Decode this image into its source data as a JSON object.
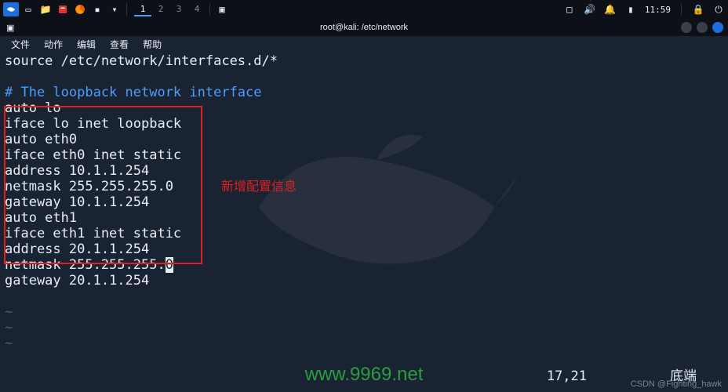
{
  "topbar": {
    "workspaces": [
      "1",
      "2",
      "3",
      "4"
    ],
    "active_workspace": 0,
    "clock": "11:59"
  },
  "window": {
    "title": "root@kali: /etc/network"
  },
  "menubar": {
    "items": [
      "文件",
      "动作",
      "编辑",
      "查看",
      "帮助"
    ]
  },
  "editor": {
    "lines": [
      {
        "text": "source /etc/network/interfaces.d/*",
        "cls": ""
      },
      {
        "text": "",
        "cls": ""
      },
      {
        "text": "# The loopback network interface",
        "cls": "comment"
      },
      {
        "text": "auto lo",
        "cls": ""
      },
      {
        "text": "iface lo inet loopback",
        "cls": ""
      },
      {
        "text": "auto eth0",
        "cls": ""
      },
      {
        "text": "iface eth0 inet static",
        "cls": ""
      },
      {
        "text": "address 10.1.1.254",
        "cls": ""
      },
      {
        "text": "netmask 255.255.255.0",
        "cls": ""
      },
      {
        "text": "gateway 10.1.1.254",
        "cls": ""
      },
      {
        "text": "auto eth1",
        "cls": ""
      },
      {
        "text": "iface eth1 inet static",
        "cls": ""
      },
      {
        "text": "address 20.1.1.254",
        "cls": ""
      }
    ],
    "cursor_line_pre": "netmask 255.255.255.",
    "cursor_char": "0",
    "after_lines": [
      {
        "text": "gateway 20.1.1.254",
        "cls": ""
      },
      {
        "text": "",
        "cls": ""
      },
      {
        "text": "~",
        "cls": "tilde"
      },
      {
        "text": "~",
        "cls": "tilde"
      },
      {
        "text": "~",
        "cls": "tilde"
      }
    ]
  },
  "annotation": "新增配置信息",
  "status": {
    "position": "17,21",
    "mode": "底端"
  },
  "watermark": {
    "url": "www.9969.net",
    "csdn": "CSDN @Fighting_hawk"
  }
}
